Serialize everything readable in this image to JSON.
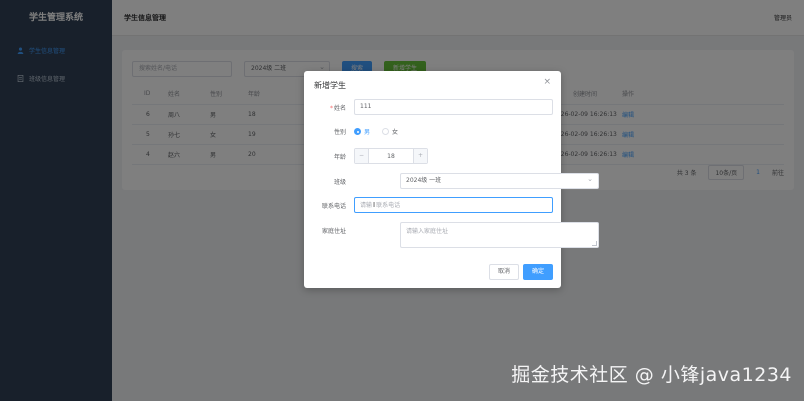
{
  "sidebar": {
    "title": "学生管理系统",
    "items": [
      {
        "label": "学生信息管理",
        "icon": "user-icon",
        "active": true
      },
      {
        "label": "班级信息管理",
        "icon": "document-icon",
        "active": false
      }
    ]
  },
  "header": {
    "breadcrumb": "学生信息管理",
    "user": "管理员"
  },
  "filters": {
    "search_placeholder": "搜索姓名/电话",
    "class_value": "2024级 二班",
    "search_button": "搜索",
    "add_button": "新增学生"
  },
  "table": {
    "columns": [
      "ID",
      "姓名",
      "性别",
      "年龄",
      "创建时间",
      "操作"
    ],
    "rows": [
      {
        "id": "6",
        "name": "周八",
        "gender": "男",
        "age": "18",
        "created": "2026-02-09 16:26:13",
        "action": "编辑"
      },
      {
        "id": "5",
        "name": "孙七",
        "gender": "女",
        "age": "19",
        "created": "2026-02-09 16:26:13",
        "action": "编辑"
      },
      {
        "id": "4",
        "name": "赵六",
        "gender": "男",
        "age": "20",
        "created": "2026-02-09 16:26:13",
        "action": "编辑"
      }
    ]
  },
  "pagination": {
    "total": "共 3 条",
    "page_size": "10条/页",
    "page": "1",
    "jump": "前往"
  },
  "dialog": {
    "title": "新增学生",
    "close": "×",
    "name_label": "姓名",
    "name_value": "111",
    "gender_label": "性别",
    "gender_male": "男",
    "gender_female": "女",
    "gender_selected": "男",
    "age_label": "年龄",
    "age_value": "18",
    "age_minus": "−",
    "age_plus": "+",
    "class_label": "班级",
    "class_value": "2024级 一班",
    "phone_label": "联系电话",
    "phone_placeholder_left": "请输",
    "phone_placeholder_right": "联系电话",
    "address_label": "家庭住址",
    "address_placeholder": "请输入家庭住址",
    "cancel_label": "取消",
    "ok_label": "确定"
  },
  "watermark": "掘金技术社区 @ 小锋java1234",
  "colors": {
    "primary": "#409eff",
    "success": "#67c23a",
    "sidebar_bg": "#304156",
    "danger": "#f56c6c"
  }
}
